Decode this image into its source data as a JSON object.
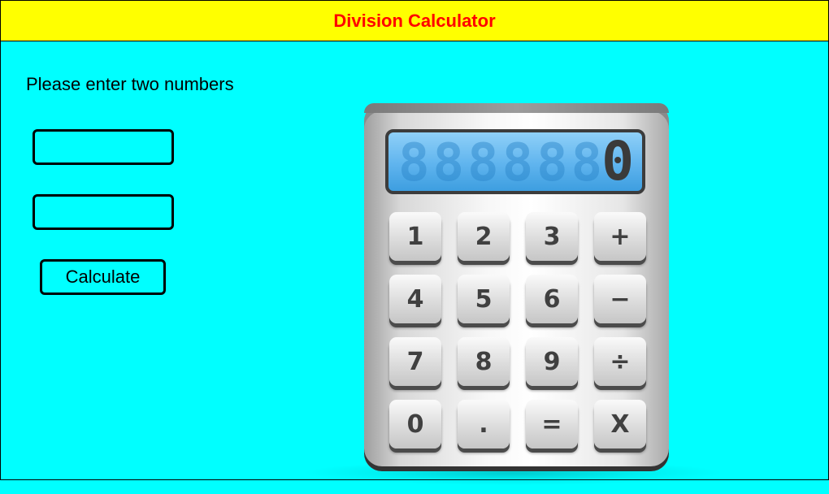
{
  "header": {
    "title": "Division Calculator"
  },
  "form": {
    "prompt": "Please enter two numbers",
    "input1_value": "",
    "input2_value": "",
    "calculate_label": "Calculate"
  },
  "calculator": {
    "display_value": "0",
    "display_ghost": "888888",
    "keys": [
      {
        "label": "1"
      },
      {
        "label": "2"
      },
      {
        "label": "3"
      },
      {
        "label": "+"
      },
      {
        "label": "4"
      },
      {
        "label": "5"
      },
      {
        "label": "6"
      },
      {
        "label": "−"
      },
      {
        "label": "7"
      },
      {
        "label": "8"
      },
      {
        "label": "9"
      },
      {
        "label": "÷"
      },
      {
        "label": "0"
      },
      {
        "label": "."
      },
      {
        "label": "="
      },
      {
        "label": "X"
      }
    ]
  },
  "colors": {
    "header_bg": "#ffff00",
    "header_text": "#ff0000",
    "page_bg": "#00ffff",
    "display_bg": "#5fb4ee"
  }
}
